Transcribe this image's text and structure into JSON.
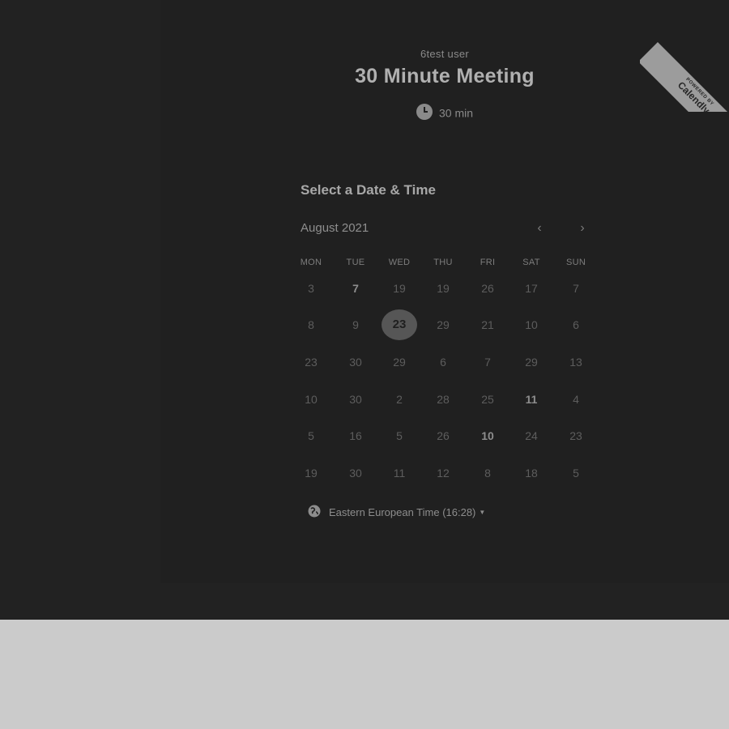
{
  "colors": {
    "overlay": "#222222",
    "card": "#202020",
    "page": "#cbcbcb",
    "selected_day": "#565656"
  },
  "header": {
    "organizer": "6test user",
    "event_title": "30 Minute Meeting",
    "duration": "30 min",
    "duration_icon": "clock-icon"
  },
  "badge": {
    "powered_by": "POWERED BY",
    "brand": "Calendly"
  },
  "calendar": {
    "heading": "Select a Date & Time",
    "month": "August 2021",
    "prev_icon": "chevron-left-icon",
    "next_icon": "chevron-right-icon",
    "weekdays": [
      "MON",
      "TUE",
      "WED",
      "THU",
      "FRI",
      "SAT",
      "SUN"
    ],
    "weeks": [
      [
        "3",
        "7",
        "19",
        "19",
        "26",
        "17",
        "7"
      ],
      [
        "8",
        "9",
        "23",
        "29",
        "21",
        "10",
        "6"
      ],
      [
        "23",
        "30",
        "29",
        "6",
        "7",
        "29",
        "13"
      ],
      [
        "10",
        "30",
        "2",
        "28",
        "25",
        "11",
        "4"
      ],
      [
        "5",
        "16",
        "5",
        "26",
        "10",
        "24",
        "23"
      ],
      [
        "19",
        "30",
        "11",
        "12",
        "8",
        "18",
        "5"
      ]
    ],
    "selected_day": "23",
    "available_days": [
      "7",
      "11",
      "10"
    ]
  },
  "timezone": {
    "label": "Eastern European Time (16:28)",
    "icon": "globe-icon"
  }
}
